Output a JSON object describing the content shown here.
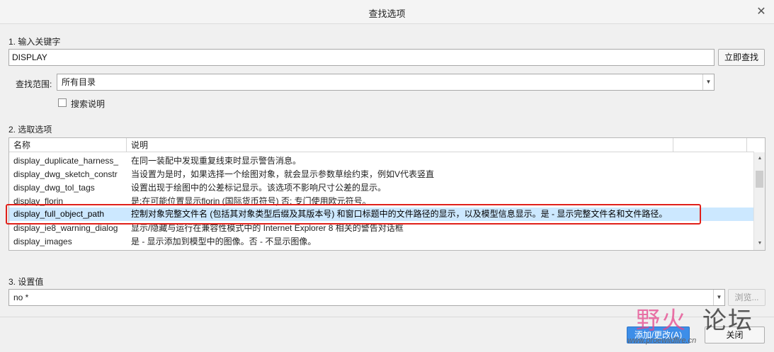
{
  "window": {
    "title": "查找选项",
    "close_glyph": "✕"
  },
  "step1": {
    "label": "1.  输入关键字",
    "keyword_value": "DISPLAY",
    "find_now_button": "立即查找",
    "scope_label": "查找范围:",
    "scope_value": "所有目录",
    "search_desc_label": "搜索说明",
    "search_desc_checked": false
  },
  "step2": {
    "label": "2.  选取选项",
    "columns": [
      "名称",
      "说明"
    ],
    "rows": [
      {
        "name": "display_duplicate_harness_",
        "desc": "在同一装配中发现重复线束时显示警告消息。",
        "selected": false
      },
      {
        "name": "display_dwg_sketch_constr",
        "desc": "当设置为是时，如果选择一个绘图对象，就会显示参数草绘约束，例如V代表竖直",
        "selected": false
      },
      {
        "name": "display_dwg_tol_tags",
        "desc": "设置出现于绘图中的公差标记显示。该选项不影响尺寸公差的显示。",
        "selected": false
      },
      {
        "name": "display_florin",
        "desc": "是:在可能位置显示florin (国际货币符号) 否: 专门使用欧元符号。",
        "selected": false
      },
      {
        "name": "display_full_object_path",
        "desc": "控制对象完整文件名 (包括其对象类型后缀及其版本号) 和窗口标题中的文件路径的显示，以及模型信息显示。是 - 显示完整文件名和文件路径。",
        "selected": true
      },
      {
        "name": "display_ie8_warning_dialog",
        "desc": "显示/隐藏与运行在兼容性模式中的 Internet Explorer 8 相关的警告对话框",
        "selected": false
      },
      {
        "name": "display_images",
        "desc": "是 - 显示添加到模型中的图像。否 - 不显示图像。",
        "selected": false
      }
    ]
  },
  "step3": {
    "label": "3.  设置值",
    "value": "no *",
    "browse_button": "浏览..."
  },
  "footer": {
    "add_change_button": "添加/更改(A)",
    "close_button": "关闭"
  },
  "watermark": {
    "text_a": "野火",
    "text_b": "论坛",
    "url": "www.proewildfire.cn"
  },
  "colors": {
    "selection": "#cce8ff",
    "highlight_box": "#e0201a",
    "primary_button": "#3d8ee8"
  }
}
